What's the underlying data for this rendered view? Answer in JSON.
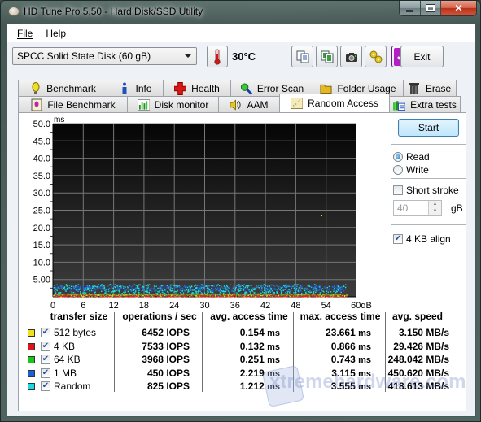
{
  "window": {
    "title": "HD Tune Pro 5.50 - Hard Disk/SSD Utility",
    "controls": [
      "minimize",
      "maximize",
      "close"
    ]
  },
  "menu": {
    "items": [
      {
        "label": "File",
        "accel": "F"
      },
      {
        "label": "Help",
        "accel": "H"
      }
    ]
  },
  "toolbar": {
    "drive": "SPCC Solid State Disk (60 gB)",
    "temperature": "30°C",
    "icons": [
      "copy-text-icon",
      "copy-screenshot-icon",
      "camera-icon",
      "options-icon",
      "save-icon"
    ],
    "exit_label": "Exit"
  },
  "tabs": {
    "row1": [
      {
        "label": "Benchmark",
        "icon": "benchmark-icon"
      },
      {
        "label": "Info",
        "icon": "info-icon"
      },
      {
        "label": "Health",
        "icon": "health-icon"
      },
      {
        "label": "Error Scan",
        "icon": "error-scan-icon"
      },
      {
        "label": "Folder Usage",
        "icon": "folder-icon"
      },
      {
        "label": "Erase",
        "icon": "trash-icon"
      }
    ],
    "row2": [
      {
        "label": "File Benchmark",
        "icon": "file-benchmark-icon"
      },
      {
        "label": "Disk monitor",
        "icon": "disk-monitor-icon"
      },
      {
        "label": "AAM",
        "icon": "speaker-icon"
      },
      {
        "label": "Random Access",
        "icon": "random-access-icon",
        "active": true
      },
      {
        "label": "Extra tests",
        "icon": "extra-tests-icon"
      }
    ]
  },
  "side": {
    "start_label": "Start",
    "read_label": "Read",
    "write_label": "Write",
    "mode": "Read",
    "short_stroke_label": "Short stroke",
    "short_stroke_checked": false,
    "short_stroke_value": "40",
    "short_stroke_unit": "gB",
    "align_label": "4 KB align",
    "align_checked": true
  },
  "chart_data": {
    "type": "scatter",
    "title": "",
    "ylabel": "ms",
    "xlabel": "gB",
    "ylim": [
      0,
      50
    ],
    "xlim": [
      0,
      60
    ],
    "grid": true,
    "yticks": [
      "50.0",
      "45.0",
      "40.0",
      "35.0",
      "30.0",
      "25.0",
      "20.0",
      "15.0",
      "10.0",
      "5.00"
    ],
    "xticks": [
      "0",
      "6",
      "12",
      "18",
      "24",
      "30",
      "36",
      "42",
      "48",
      "54",
      "60gB"
    ],
    "series": [
      {
        "name": "512 bytes",
        "color": "#f0e020",
        "y_range_ms": [
          0.0,
          0.4
        ]
      },
      {
        "name": "4 KB",
        "color": "#e02020",
        "y_range_ms": [
          0.0,
          0.3
        ]
      },
      {
        "name": "64 KB",
        "color": "#20c020",
        "y_range_ms": [
          0.1,
          0.8
        ]
      },
      {
        "name": "1 MB",
        "color": "#2060e0",
        "y_range_ms": [
          1.5,
          3.1
        ]
      },
      {
        "name": "Random",
        "color": "#20e0e0",
        "y_range_ms": [
          0.2,
          3.5
        ]
      }
    ]
  },
  "results": {
    "headers": [
      "transfer size",
      "operations / sec",
      "avg. access time",
      "max. access time",
      "avg. speed"
    ],
    "rows": [
      {
        "color": "#f0e020",
        "checked": true,
        "size": "512 bytes",
        "ops": "6452",
        "ops_unit": "IOPS",
        "avg": "0.154",
        "max": "23.661",
        "time_unit": "ms",
        "speed": "3.150",
        "speed_unit": "MB/s"
      },
      {
        "color": "#d81818",
        "checked": true,
        "size": "4 KB",
        "ops": "7533",
        "ops_unit": "IOPS",
        "avg": "0.132",
        "max": "0.866",
        "time_unit": "ms",
        "speed": "29.426",
        "speed_unit": "MB/s"
      },
      {
        "color": "#18c818",
        "checked": true,
        "size": "64 KB",
        "ops": "3968",
        "ops_unit": "IOPS",
        "avg": "0.251",
        "max": "0.743",
        "time_unit": "ms",
        "speed": "248.042",
        "speed_unit": "MB/s"
      },
      {
        "color": "#1860d8",
        "checked": true,
        "size": "1 MB",
        "ops": "450",
        "ops_unit": "IOPS",
        "avg": "2.219",
        "max": "3.115",
        "time_unit": "ms",
        "speed": "450.620",
        "speed_unit": "MB/s"
      },
      {
        "color": "#20d8e0",
        "checked": true,
        "size": "Random",
        "ops": "825",
        "ops_unit": "IOPS",
        "avg": "1.212",
        "max": "3.555",
        "time_unit": "ms",
        "speed": "418.613",
        "speed_unit": "MB/s"
      }
    ]
  },
  "watermark": "xtremehardware.com"
}
